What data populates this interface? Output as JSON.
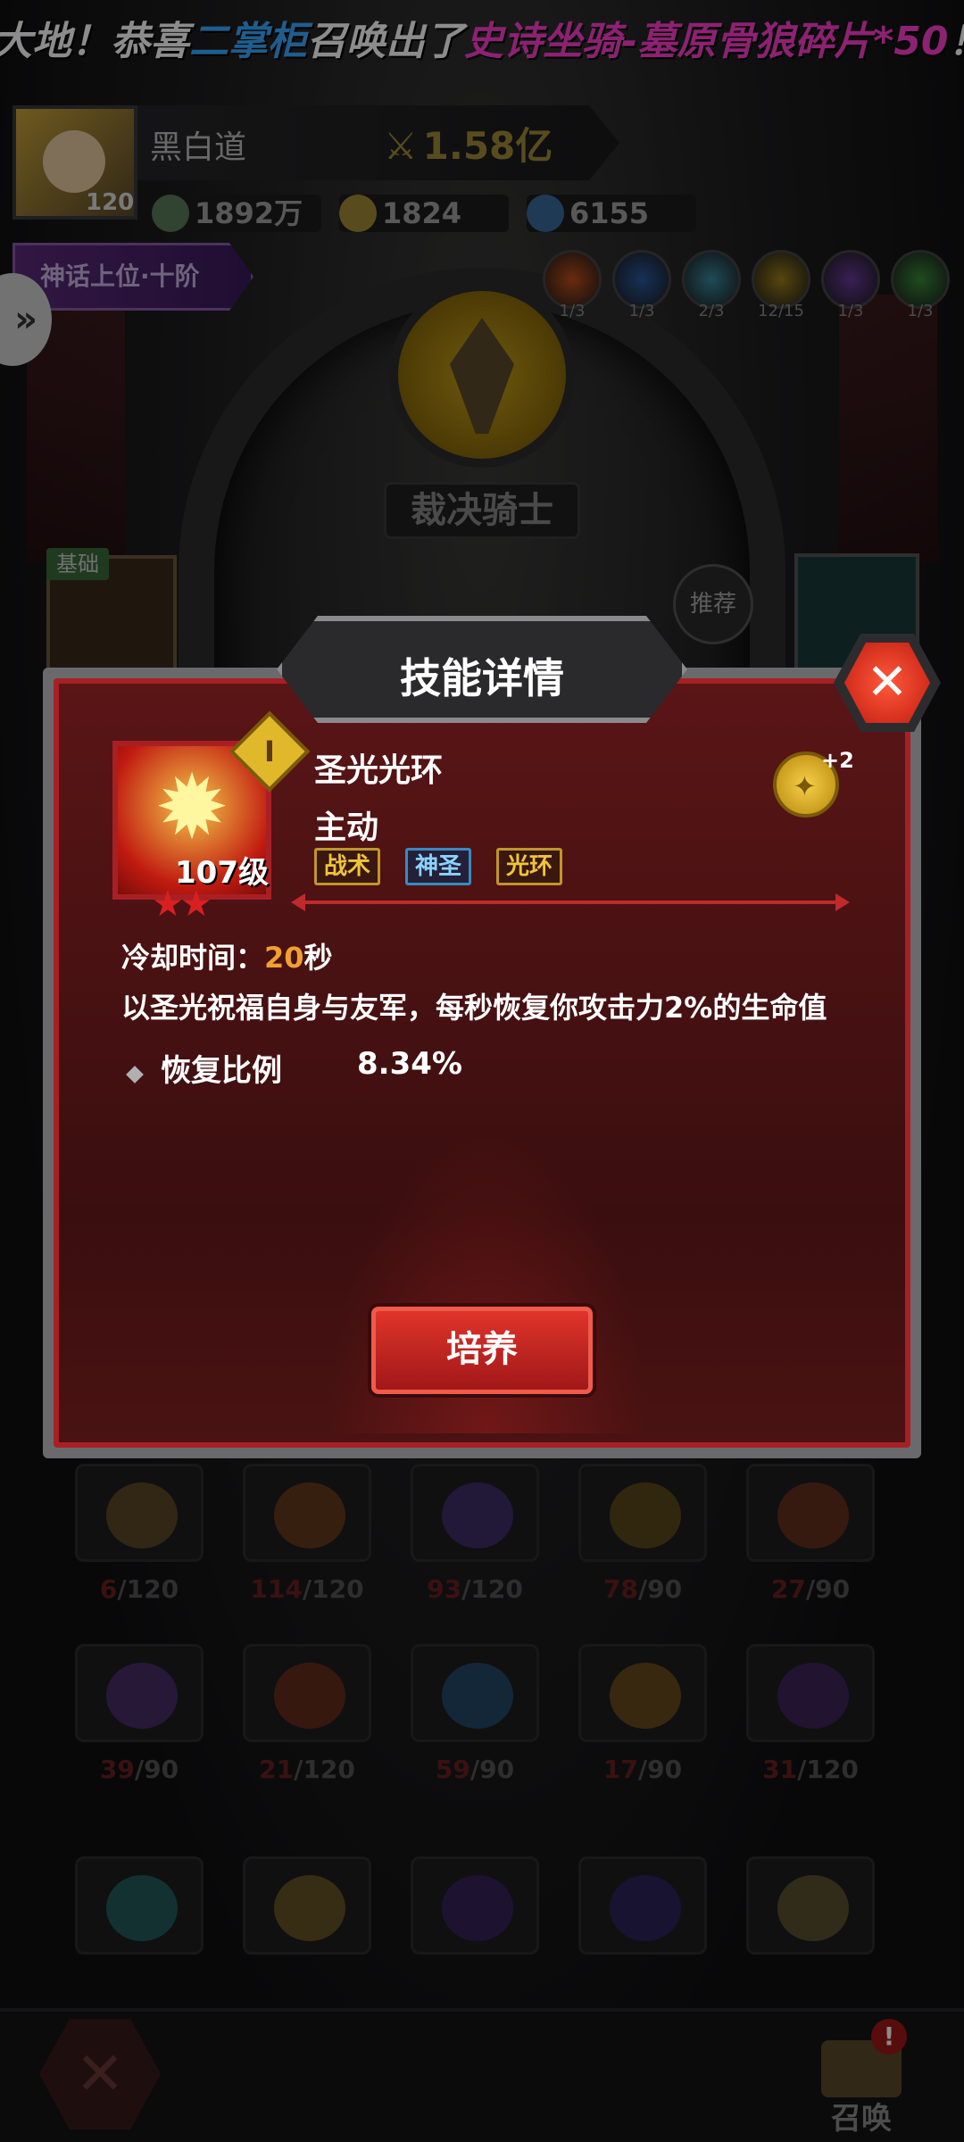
{
  "marquee": {
    "prefix": "大地！恭喜",
    "player": "二掌柜",
    "middle": "召唤出了",
    "item": "史诗坐骑-墓原骨狼碎片*50",
    "suffix": "！"
  },
  "player": {
    "name": "黑白道",
    "level": "120",
    "power": "1.58亿"
  },
  "resources": [
    "1892万",
    "1824",
    "6155"
  ],
  "rank_tag": "神话上位·十阶",
  "elements": [
    {
      "icon": "fire-element-icon",
      "count": "1/3",
      "color": "#c0501a"
    },
    {
      "icon": "water-element-icon",
      "count": "1/3",
      "color": "#2a5aa0"
    },
    {
      "icon": "ice-element-icon",
      "count": "2/3",
      "color": "#3a8aa0"
    },
    {
      "icon": "light-element-icon",
      "count": "12/15",
      "color": "#a0801a"
    },
    {
      "icon": "dark-element-icon",
      "count": "1/3",
      "color": "#6a3a9a"
    },
    {
      "icon": "nature-element-icon",
      "count": "1/3",
      "color": "#3a8a3a"
    }
  ],
  "class_name": "裁决骑士",
  "basic_tag": "基础",
  "recommend": "推荐",
  "modal": {
    "title": "技能详情",
    "close_icon": "✕",
    "skill": {
      "name": "圣光光环",
      "type": "主动",
      "level": "107级",
      "rank": "I",
      "plus_count": "+2",
      "tags": [
        "战术",
        "神圣",
        "光环"
      ],
      "cooldown_label": "冷却时间：",
      "cooldown_value": "20",
      "cooldown_unit": "秒",
      "description": "以圣光祝福自身与友军，每秒恢复你攻击力2%的生命值",
      "stat_label": "恢复比例",
      "stat_value": "8.34%"
    },
    "train_button": "培养"
  },
  "shards": [
    {
      "cur": "6",
      "max": "/120",
      "color": "#8a6a2a"
    },
    {
      "cur": "114",
      "max": "/120",
      "color": "#a0501a"
    },
    {
      "cur": "93",
      "max": "/120",
      "color": "#5a3aa0"
    },
    {
      "cur": "78",
      "max": "/90",
      "color": "#8a6a1a"
    },
    {
      "cur": "27",
      "max": "/90",
      "color": "#a0401a"
    },
    {
      "cur": "39",
      "max": "/90",
      "color": "#6a3aa0"
    },
    {
      "cur": "21",
      "max": "/120",
      "color": "#a03a1a"
    },
    {
      "cur": "59",
      "max": "/90",
      "color": "#2a6aa0"
    },
    {
      "cur": "17",
      "max": "/90",
      "color": "#a0701a"
    },
    {
      "cur": "31",
      "max": "/120",
      "color": "#5a2a8a"
    },
    {
      "cur": "",
      "max": "",
      "color": "#2a8a8a"
    },
    {
      "cur": "",
      "max": "",
      "color": "#a07a2a"
    },
    {
      "cur": "",
      "max": "",
      "color": "#4a2a8a"
    },
    {
      "cur": "",
      "max": "",
      "color": "#3a2a8a"
    },
    {
      "cur": "",
      "max": "",
      "color": "#8a7a3a"
    }
  ],
  "bottom": {
    "summon_label": "召唤",
    "alert": "!",
    "close_icon": "✕"
  }
}
